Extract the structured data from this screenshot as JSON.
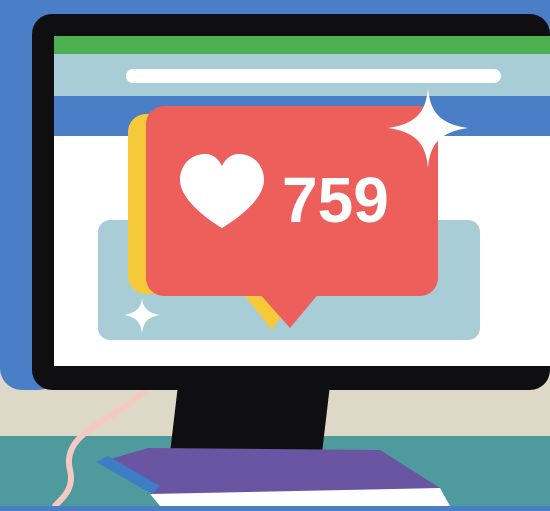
{
  "notification": {
    "count": "759",
    "icon": "heart-icon"
  },
  "colors": {
    "background_blue": "#4a7ec7",
    "wall": "#ddd8c8",
    "desk": "#4f9a9c",
    "monitor_bezel": "#0f0f12",
    "browser_top_bar": "#4caf50",
    "address_bar_bg": "#a9cdd6",
    "nav_bar": "#4a7ec7",
    "page_bg": "#ffffff",
    "content_card": "#a9cdd6",
    "bubble_red": "#ec5f5b",
    "bubble_yellow": "#f5c93a",
    "keyboard_purple": "#6a55a2"
  }
}
